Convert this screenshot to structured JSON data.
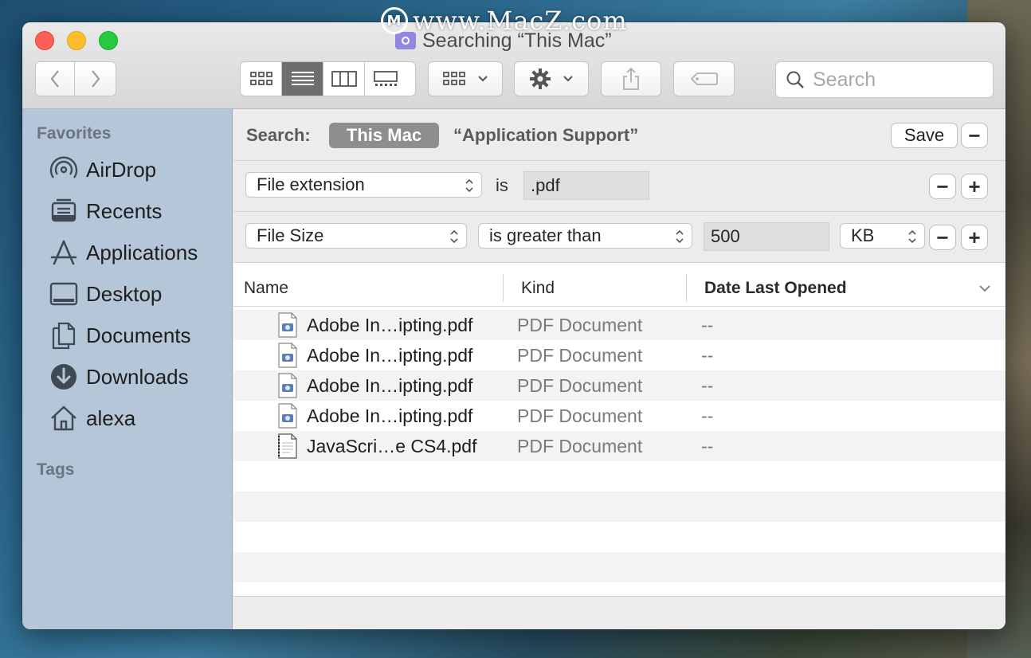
{
  "watermark": {
    "logo_letter": "M",
    "text": "www.MacZ.com"
  },
  "window": {
    "title": "Searching “This Mac”"
  },
  "toolbar": {
    "search_placeholder": "Search"
  },
  "sidebar": {
    "favorites_label": "Favorites",
    "items": [
      {
        "label": "AirDrop",
        "icon": "airdrop-icon"
      },
      {
        "label": "Recents",
        "icon": "recents-icon"
      },
      {
        "label": "Applications",
        "icon": "applications-icon"
      },
      {
        "label": "Desktop",
        "icon": "desktop-icon"
      },
      {
        "label": "Documents",
        "icon": "documents-icon"
      },
      {
        "label": "Downloads",
        "icon": "downloads-icon"
      },
      {
        "label": "alexa",
        "icon": "home-icon"
      }
    ],
    "tags_label": "Tags"
  },
  "search_scope": {
    "label": "Search:",
    "active_scope": "This Mac",
    "other_scope": "“Application Support”",
    "save_label": "Save",
    "minus": "−"
  },
  "criteria": [
    {
      "attribute": "File extension",
      "operator": "is",
      "value": ".pdf"
    },
    {
      "attribute": "File Size",
      "operator": "is greater than",
      "value": "500",
      "unit": "KB"
    }
  ],
  "buttons": {
    "minus": "−",
    "plus": "+"
  },
  "columns": {
    "name": "Name",
    "kind": "Kind",
    "date": "Date Last Opened"
  },
  "files": [
    {
      "name": "Adobe In…ipting.pdf",
      "kind": "PDF Document",
      "date": "--"
    },
    {
      "name": "Adobe In…ipting.pdf",
      "kind": "PDF Document",
      "date": "--"
    },
    {
      "name": "Adobe In…ipting.pdf",
      "kind": "PDF Document",
      "date": "--"
    },
    {
      "name": "Adobe In…ipting.pdf",
      "kind": "PDF Document",
      "date": "--"
    },
    {
      "name": "JavaScri…e CS4.pdf",
      "kind": "PDF Document",
      "date": "--"
    }
  ]
}
